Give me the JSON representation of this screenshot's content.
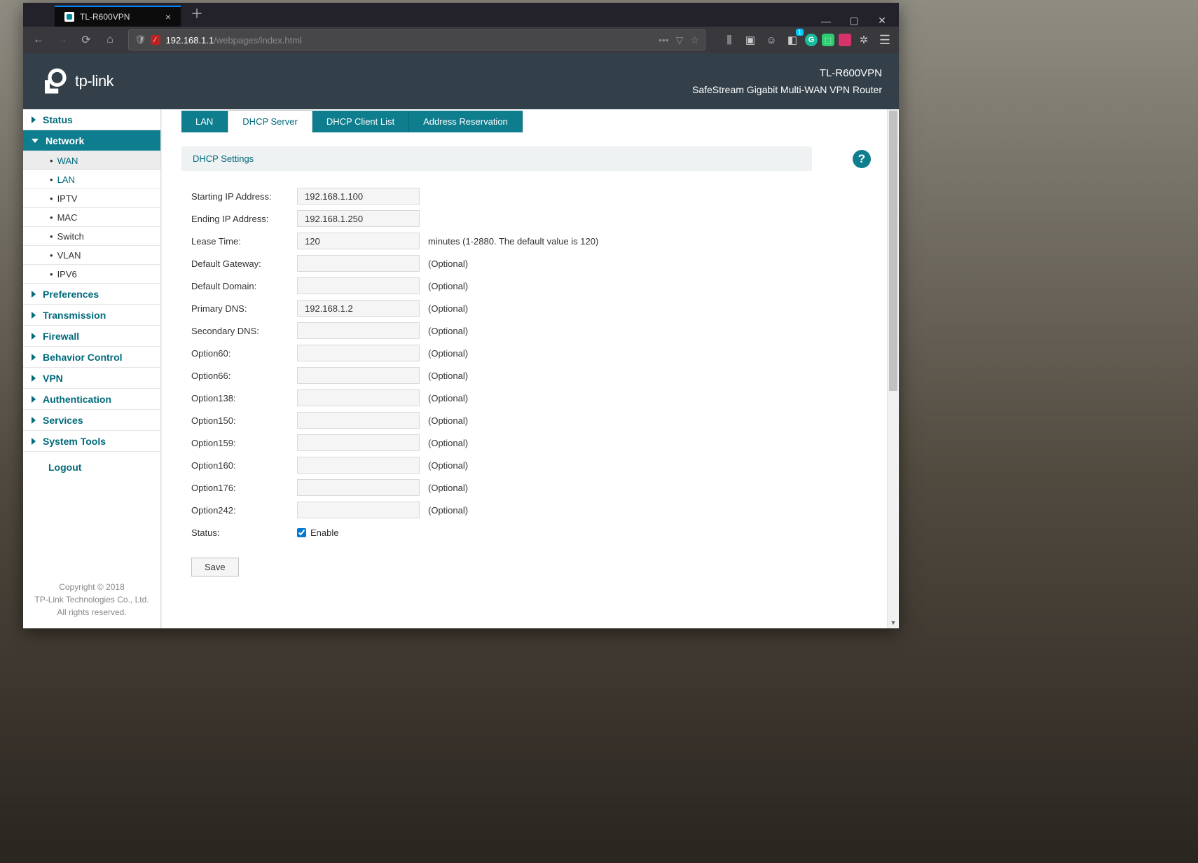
{
  "browser_tab": {
    "title": "TL-R600VPN"
  },
  "url": {
    "host": "192.168.1.1",
    "path": "/webpages/index.html"
  },
  "header": {
    "brand": "tp-link",
    "model": "TL-R600VPN",
    "desc": "SafeStream Gigabit Multi-WAN VPN Router"
  },
  "sidebar": {
    "items": [
      {
        "label": "Status",
        "expanded": false
      },
      {
        "label": "Network",
        "expanded": true,
        "subs": [
          {
            "label": "WAN",
            "active": false,
            "highlight": true
          },
          {
            "label": "LAN",
            "active": true,
            "highlight": false
          },
          {
            "label": "IPTV"
          },
          {
            "label": "MAC"
          },
          {
            "label": "Switch"
          },
          {
            "label": "VLAN"
          },
          {
            "label": "IPV6"
          }
        ]
      },
      {
        "label": "Preferences"
      },
      {
        "label": "Transmission"
      },
      {
        "label": "Firewall"
      },
      {
        "label": "Behavior Control"
      },
      {
        "label": "VPN"
      },
      {
        "label": "Authentication"
      },
      {
        "label": "Services"
      },
      {
        "label": "System Tools"
      }
    ],
    "logout": "Logout"
  },
  "copyright": {
    "line1": "Copyright © 2018",
    "line2": "TP-Link Technologies Co., Ltd.",
    "line3": "All rights reserved."
  },
  "tabs": [
    {
      "label": "LAN",
      "active": false
    },
    {
      "label": "DHCP Server",
      "active": true
    },
    {
      "label": "DHCP Client List",
      "active": false
    },
    {
      "label": "Address Reservation",
      "active": false
    }
  ],
  "section_title": "DHCP Settings",
  "form": {
    "rows": [
      {
        "label": "Starting IP Address:",
        "value": "192.168.1.100",
        "hint": ""
      },
      {
        "label": "Ending IP Address:",
        "value": "192.168.1.250",
        "hint": ""
      },
      {
        "label": "Lease Time:",
        "value": "120",
        "hint": "minutes (1-2880. The default value is 120)"
      },
      {
        "label": "Default Gateway:",
        "value": "",
        "hint": "(Optional)"
      },
      {
        "label": "Default Domain:",
        "value": "",
        "hint": "(Optional)"
      },
      {
        "label": "Primary DNS:",
        "value": "192.168.1.2",
        "hint": "(Optional)"
      },
      {
        "label": "Secondary DNS:",
        "value": "",
        "hint": "(Optional)"
      },
      {
        "label": "Option60:",
        "value": "",
        "hint": "(Optional)"
      },
      {
        "label": "Option66:",
        "value": "",
        "hint": "(Optional)"
      },
      {
        "label": "Option138:",
        "value": "",
        "hint": "(Optional)"
      },
      {
        "label": "Option150:",
        "value": "",
        "hint": "(Optional)"
      },
      {
        "label": "Option159:",
        "value": "",
        "hint": "(Optional)"
      },
      {
        "label": "Option160:",
        "value": "",
        "hint": "(Optional)"
      },
      {
        "label": "Option176:",
        "value": "",
        "hint": "(Optional)"
      },
      {
        "label": "Option242:",
        "value": "",
        "hint": "(Optional)"
      }
    ],
    "status_label": "Status:",
    "status_option": "Enable",
    "status_checked": true,
    "save": "Save"
  }
}
